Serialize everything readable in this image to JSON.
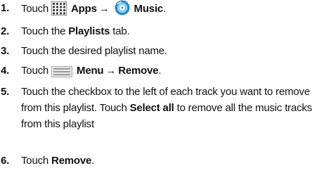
{
  "steps": [
    {
      "number": "1.",
      "text_a": "Touch",
      "apps_icon": "apps-grid-icon",
      "apps_label": "Apps",
      "arrow": "→",
      "music_icon": "music-app-icon",
      "music_label": "Music",
      "end": "."
    },
    {
      "number": "2.",
      "text_a": "Touch the",
      "bold": "Playlists",
      "text_b": "tab."
    },
    {
      "number": "3.",
      "text": "Touch the desired playlist name."
    },
    {
      "number": "4.",
      "text_a": "Touch",
      "menu_icon": "menu-key-icon",
      "menu_label": "Menu",
      "arrow": "→",
      "remove_label": "Remove",
      "end": "."
    },
    {
      "number": "5.",
      "text_a": "Touch the checkbox to the left of each track you want to remove from this playlist. Touch",
      "bold": "Select all",
      "text_b": "to remove all the music tracks from this playlist"
    },
    {
      "number": "6.",
      "text_a": "Touch",
      "bold": "Remove",
      "end": "."
    }
  ]
}
